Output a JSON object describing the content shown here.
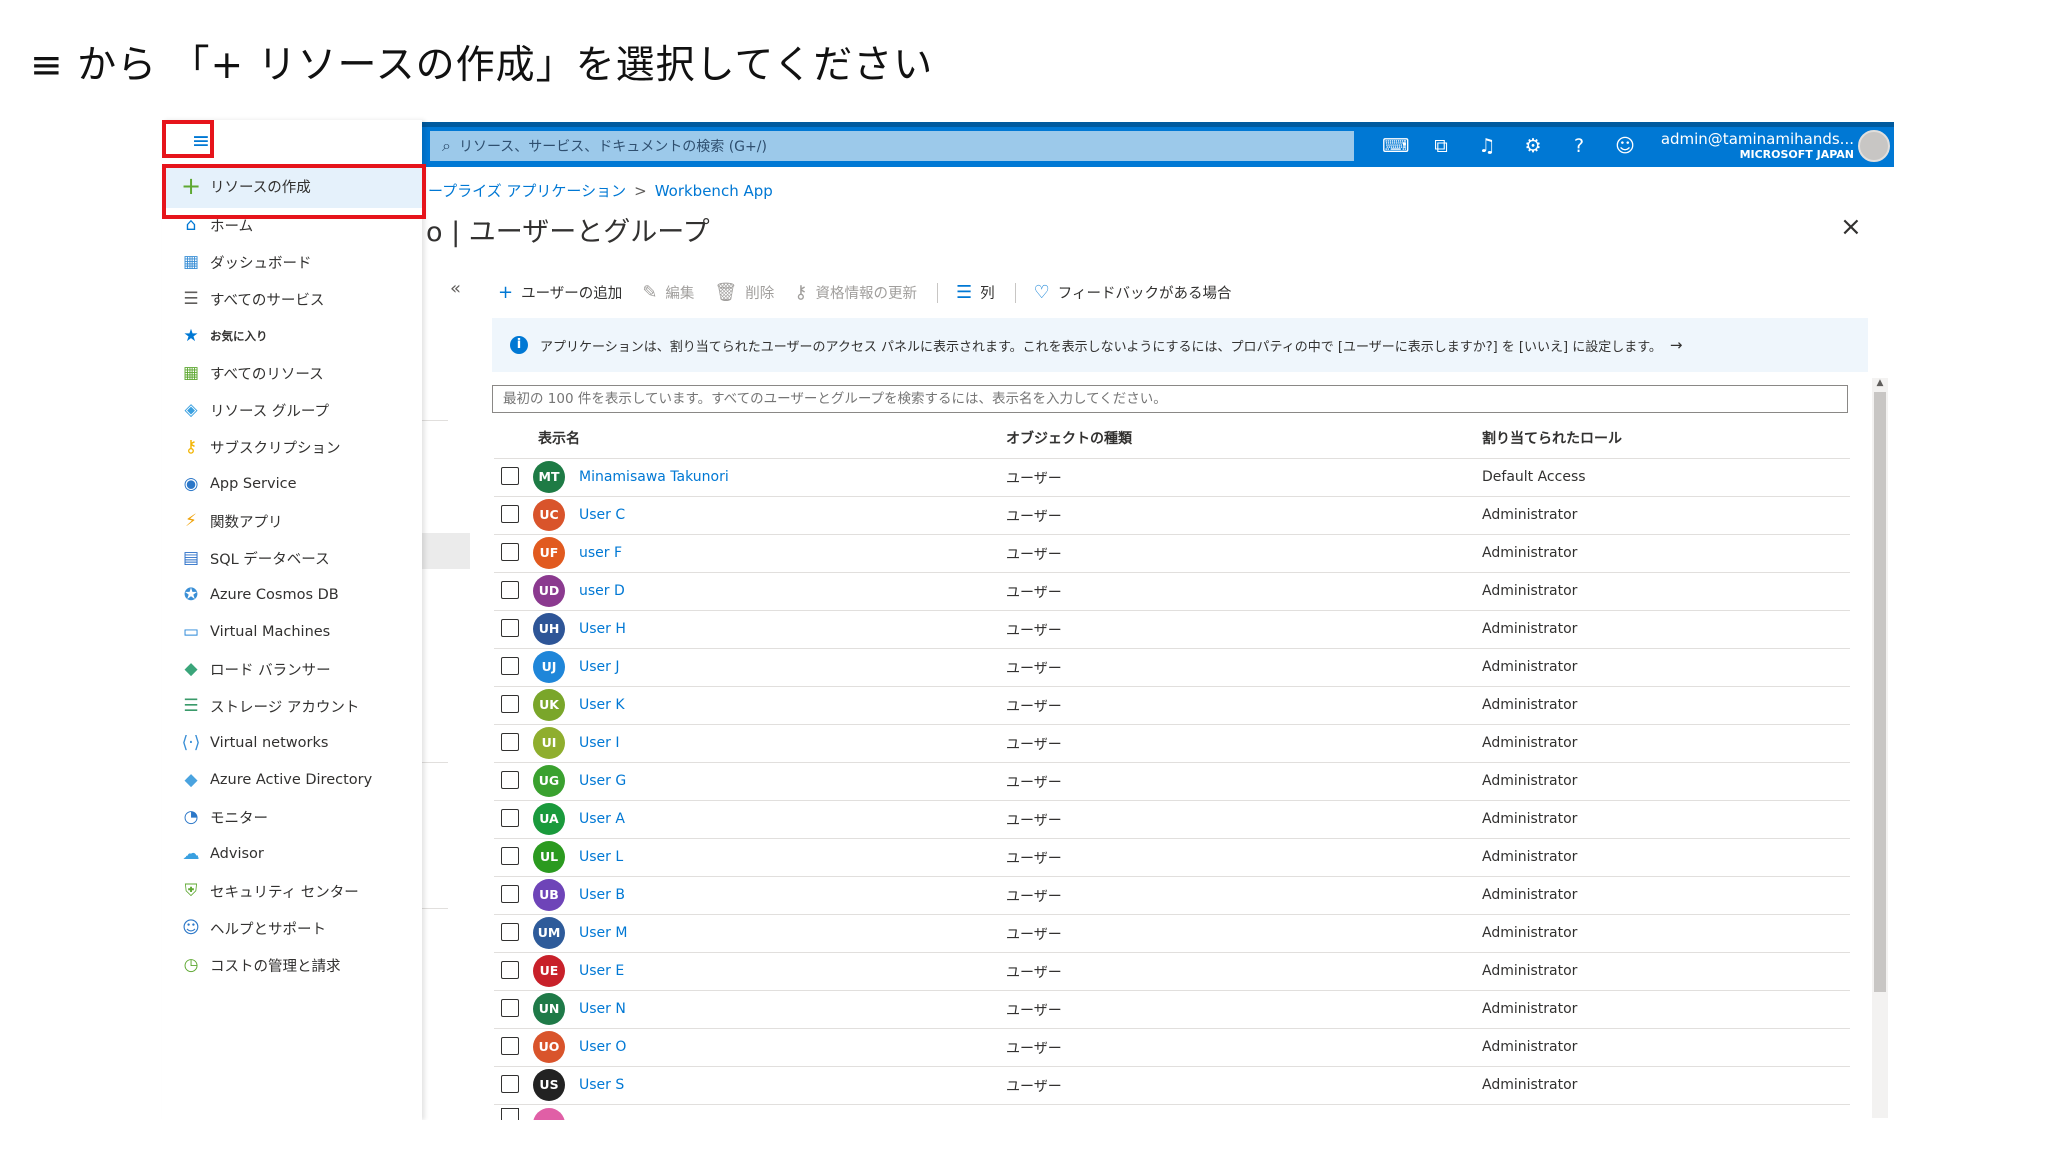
{
  "instruction": "≡ から 「+ リソースの作成」を選択してください",
  "topbar": {
    "search_placeholder": "リソース、サービス、ドキュメントの検索 (G+/)",
    "account_user": "admin@taminamihands...",
    "account_tenant": "MICROSOFT JAPAN",
    "icons": [
      "cloud-shell-icon",
      "directory-filter-icon",
      "notifications-icon",
      "settings-icon",
      "help-icon",
      "feedback-smiley-icon"
    ]
  },
  "breadcrumb": {
    "item1": "ープライズ アプリケーション",
    "separator": ">",
    "item2": "Workbench App"
  },
  "page_title": "o | ユーザーとグループ",
  "collapse_glyph": "«",
  "close_glyph": "×",
  "commands": {
    "add_user": "ユーザーの追加",
    "edit": "編集",
    "delete": "削除",
    "update_credentials": "資格情報の更新",
    "columns": "列",
    "feedback": "フィードバックがある場合"
  },
  "banner": {
    "text": "アプリケーションは、割り当てられたユーザーのアクセス パネルに表示されます。これを表示しないようにするには、プロパティの中で [ユーザーに表示しますか?] を [いいえ] に設定します。",
    "arrow": "→"
  },
  "filter_placeholder": "最初の 100 件を表示しています。すべてのユーザーとグループを検索するには、表示名を入力してください。",
  "table": {
    "headers": [
      "表示名",
      "オブジェクトの種類",
      "割り当てられたロール"
    ],
    "rows": [
      {
        "initials": "MT",
        "name": "Minamisawa Takunori",
        "type": "ユーザー",
        "role": "Default Access",
        "color": "#1e7b45"
      },
      {
        "initials": "UC",
        "name": "User C",
        "type": "ユーザー",
        "role": "Administrator",
        "color": "#d9542b"
      },
      {
        "initials": "UF",
        "name": "user F",
        "type": "ユーザー",
        "role": "Administrator",
        "color": "#e15a1f"
      },
      {
        "initials": "UD",
        "name": "user D",
        "type": "ユーザー",
        "role": "Administrator",
        "color": "#8b3a8f"
      },
      {
        "initials": "UH",
        "name": "User H",
        "type": "ユーザー",
        "role": "Administrator",
        "color": "#2e5597"
      },
      {
        "initials": "UJ",
        "name": "User J",
        "type": "ユーザー",
        "role": "Administrator",
        "color": "#1f86d9"
      },
      {
        "initials": "UK",
        "name": "User K",
        "type": "ユーザー",
        "role": "Administrator",
        "color": "#7aa62a"
      },
      {
        "initials": "UI",
        "name": "User I",
        "type": "ユーザー",
        "role": "Administrator",
        "color": "#8fae2e"
      },
      {
        "initials": "UG",
        "name": "User G",
        "type": "ユーザー",
        "role": "Administrator",
        "color": "#3aa12f"
      },
      {
        "initials": "UA",
        "name": "User A",
        "type": "ユーザー",
        "role": "Administrator",
        "color": "#1a9a3c"
      },
      {
        "initials": "UL",
        "name": "User L",
        "type": "ユーザー",
        "role": "Administrator",
        "color": "#2b9a1f"
      },
      {
        "initials": "UB",
        "name": "User B",
        "type": "ユーザー",
        "role": "Administrator",
        "color": "#6e44b8"
      },
      {
        "initials": "UM",
        "name": "User M",
        "type": "ユーザー",
        "role": "Administrator",
        "color": "#2e5b9a"
      },
      {
        "initials": "UE",
        "name": "User E",
        "type": "ユーザー",
        "role": "Administrator",
        "color": "#c8212a"
      },
      {
        "initials": "UN",
        "name": "User N",
        "type": "ユーザー",
        "role": "Administrator",
        "color": "#1f7a48"
      },
      {
        "initials": "UO",
        "name": "User O",
        "type": "ユーザー",
        "role": "Administrator",
        "color": "#d9542b"
      },
      {
        "initials": "US",
        "name": "User S",
        "type": "ユーザー",
        "role": "Administrator",
        "color": "#222222"
      }
    ]
  },
  "sidebar": {
    "menu_glyph": "≡",
    "create": {
      "label": "リソースの作成",
      "icon": "plus-icon"
    },
    "items": [
      {
        "label": "ホーム",
        "icon": "home-icon",
        "glyph": "⌂",
        "color": "#0078d4"
      },
      {
        "label": "ダッシュボード",
        "icon": "dashboard-icon",
        "glyph": "▦",
        "color": "#3a8fd6"
      },
      {
        "label": "すべてのサービス",
        "icon": "all-services-icon",
        "glyph": "☰",
        "color": "#605e5c"
      },
      {
        "label": "お気に入り",
        "icon": "favorites-star-icon",
        "glyph": "★",
        "color": "#0078d4",
        "small": true
      },
      {
        "label": "すべてのリソース",
        "icon": "all-resources-icon",
        "glyph": "▦",
        "color": "#5ea832"
      },
      {
        "label": "リソース グループ",
        "icon": "resource-groups-icon",
        "glyph": "◈",
        "color": "#3aa0e0"
      },
      {
        "label": "サブスクリプション",
        "icon": "subscriptions-key-icon",
        "glyph": "⚷",
        "color": "#f2b400"
      },
      {
        "label": "App Service",
        "icon": "app-service-icon",
        "glyph": "◉",
        "color": "#2b77c8"
      },
      {
        "label": "関数アプリ",
        "icon": "function-apps-icon",
        "glyph": "⚡",
        "color": "#f0a30a"
      },
      {
        "label": "SQL データベース",
        "icon": "sql-database-icon",
        "glyph": "▤",
        "color": "#2b6fc7"
      },
      {
        "label": "Azure Cosmos DB",
        "icon": "cosmos-db-icon",
        "glyph": "✪",
        "color": "#3a8fd6"
      },
      {
        "label": "Virtual Machines",
        "icon": "virtual-machines-icon",
        "glyph": "▭",
        "color": "#2b88d8"
      },
      {
        "label": "ロード バランサー",
        "icon": "load-balancer-icon",
        "glyph": "◆",
        "color": "#3aa57a"
      },
      {
        "label": "ストレージ アカウント",
        "icon": "storage-accounts-icon",
        "glyph": "☰",
        "color": "#3a9a6a"
      },
      {
        "label": "Virtual networks",
        "icon": "virtual-networks-icon",
        "glyph": "⟨·⟩",
        "color": "#3a8fd6"
      },
      {
        "label": "Azure Active Directory",
        "icon": "azure-ad-icon",
        "glyph": "◆",
        "color": "#4aa3df"
      },
      {
        "label": "モニター",
        "icon": "monitor-icon",
        "glyph": "◔",
        "color": "#2b77c8"
      },
      {
        "label": "Advisor",
        "icon": "advisor-icon",
        "glyph": "☁",
        "color": "#3aa0e0"
      },
      {
        "label": "セキュリティ センター",
        "icon": "security-center-icon",
        "glyph": "⛨",
        "color": "#5ea832"
      },
      {
        "label": "ヘルプとサポート",
        "icon": "help-support-icon",
        "glyph": "☺",
        "color": "#2b77c8"
      },
      {
        "label": "コストの管理と請求",
        "icon": "cost-management-icon",
        "glyph": "◷",
        "color": "#5ea832"
      }
    ]
  },
  "highlight_color": "#e6141b"
}
